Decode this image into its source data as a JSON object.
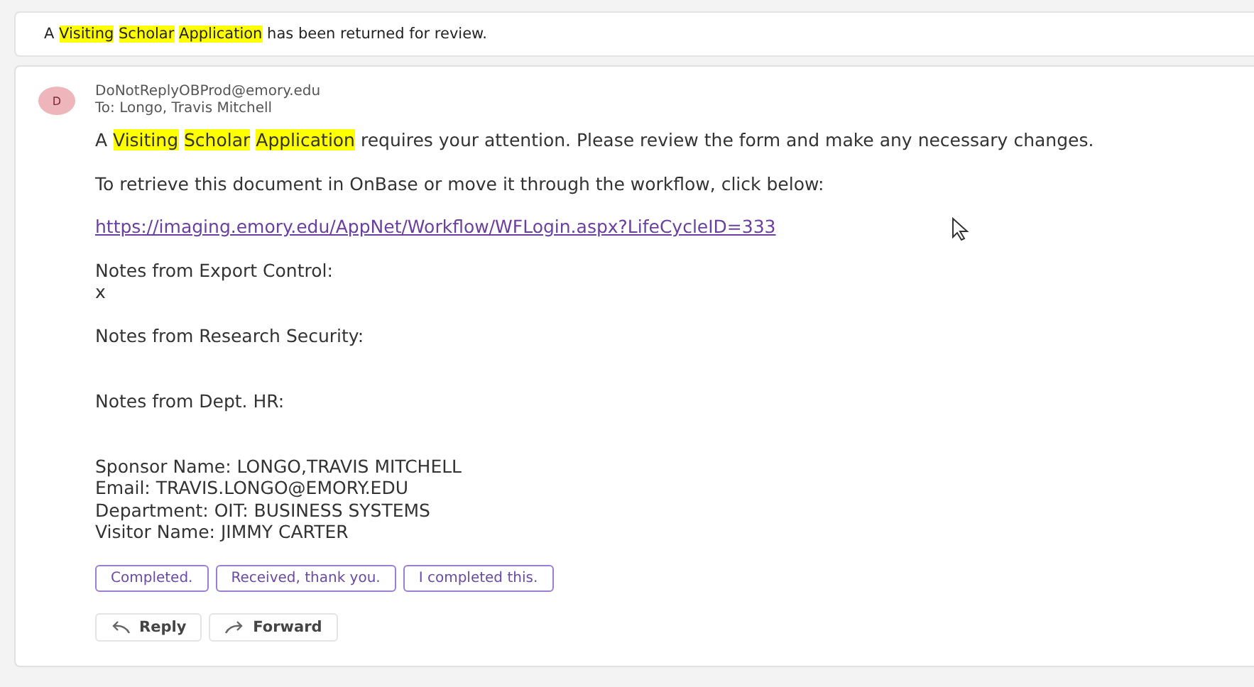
{
  "subject": [
    {
      "text": "A",
      "highlighted": false
    },
    {
      "text": "Visiting Scholar Application",
      "highlighted": true
    },
    {
      "text": "has been returned for review.",
      "highlighted": false
    }
  ],
  "message": {
    "avatar": "D",
    "from": "DoNotReplyOBProd@emory.edu",
    "to": "To: Longo, Travis Mitchell",
    "body": [
      {
        "kind": "segments",
        "segments": [
          {
            "text": "A",
            "highlighted": false
          },
          {
            "text": "Visiting Scholar Application",
            "highlighted": true
          },
          {
            "text": "requires your attention. Please review the form and make any necessary changes.",
            "highlighted": false
          }
        ]
      },
      {
        "kind": "text",
        "text": "To retrieve this document in OnBase or move it through the workflow, click below:"
      },
      {
        "kind": "link",
        "text": "https://imaging.emory.edu/AppNet/Workflow/WFLogin.aspx?LifeCycleID=333"
      },
      {
        "kind": "notes",
        "heading": "Notes from Export Control:",
        "note": "x"
      },
      {
        "kind": "notes",
        "heading": "Notes from Research Security:"
      },
      {
        "kind": "notes",
        "heading": "Notes from Dept. HR:"
      },
      {
        "kind": "lines",
        "lines": [
          "Sponsor Name: LONGO,TRAVIS MITCHELL",
          "Email: TRAVIS.LONGO@EMORY.EDU",
          "Department: OIT: BUSINESS SYSTEMS",
          "Visitor Name: JIMMY CARTER"
        ]
      }
    ],
    "suggestions": [
      "Completed.",
      "Received, thank you.",
      "I completed this."
    ],
    "actions": [
      {
        "kind": "reply",
        "label": "Reply"
      },
      {
        "kind": "forward",
        "label": "Forward"
      }
    ]
  }
}
